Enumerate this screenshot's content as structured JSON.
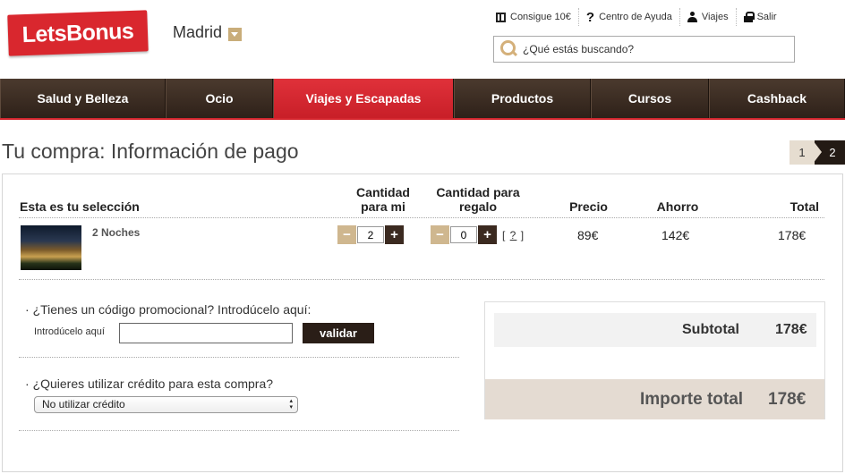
{
  "brand": {
    "logo_text": "LetsBonus",
    "accent": "#d9272e",
    "nav_bg": "#3a2a20",
    "gold": "#c9ad7a"
  },
  "header": {
    "city": "Madrid",
    "links": {
      "gift": "Consigue 10€",
      "help": "Centro de Ayuda",
      "trips": "Viajes",
      "logout": "Salir"
    },
    "search_placeholder": "¿Qué estás buscando?"
  },
  "nav": {
    "items": [
      "Salud y Belleza",
      "Ocio",
      "Viajes y Escapadas",
      "Productos",
      "Cursos",
      "Cashback"
    ],
    "active": "Viajes y Escapadas"
  },
  "page": {
    "title": "Tu compra: Información de pago",
    "steps": [
      "1",
      "2"
    ],
    "current_step": "2"
  },
  "table": {
    "headers": {
      "selection": "Esta es tu selección",
      "qty_me_1": "Cantidad",
      "qty_me_2": "para mi",
      "qty_gift_1": "Cantidad para",
      "qty_gift_2": "regalo",
      "price": "Precio",
      "saving": "Ahorro",
      "total": "Total"
    },
    "row": {
      "name": "2 Noches",
      "qty_me": "2",
      "qty_gift": "0",
      "help": "?",
      "price": "89€",
      "saving": "142€",
      "total": "178€"
    },
    "minus": "−",
    "plus": "+"
  },
  "promo": {
    "title": "¿Tienes un código promocional? Introdúcelo aquí:",
    "label": "Introdúcelo aquí",
    "button": "validar"
  },
  "credit": {
    "title": "¿Quieres utilizar crédito para esta compra?",
    "selected": "No utilizar crédito"
  },
  "summary": {
    "subtotal_label": "Subtotal",
    "subtotal_value": "178€",
    "total_label": "Importe total",
    "total_value": "178€"
  }
}
